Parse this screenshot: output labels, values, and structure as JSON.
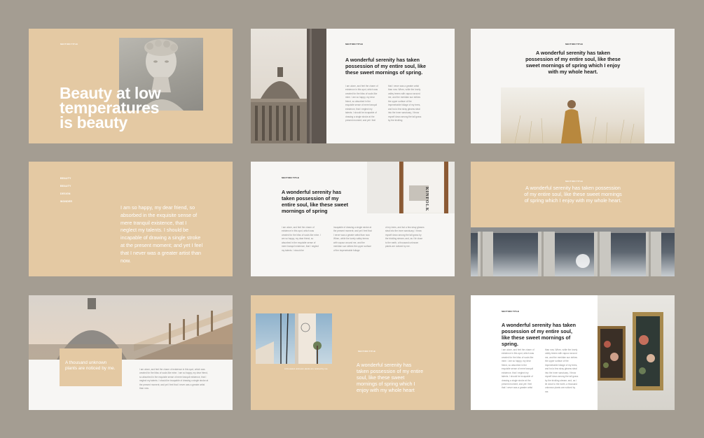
{
  "slide1": {
    "tag": "SECTION TITLE",
    "title_l1": "Beauty at low",
    "title_l2": "temperatures",
    "title_l3": "is beauty"
  },
  "slide2": {
    "tag": "SECTION TITLE",
    "heading": "A wonderful serenity has taken possession of my entire soul, like these sweet mornings of spring.",
    "col1": "I am alone, and feel the charm of existence in this spot, which was created for the bliss of souls like mine. I am so happy, my dear friend, so absorbed in the exquisite sense of mere tranquil existence, that I neglect my talents. I should be incapable of drawing a single stroke at the present moment; and yet I feel",
    "col2": "that I never was a greater artist than now. When, while the lovely valley teems with vapour around me, and the meridian sun strikes the upper surface of the impenetrable foliage of my trees, and but a few stray gleams steal into the inner sanctuary, I throw myself down among the tall grass by the trickling"
  },
  "slide3": {
    "tag": "SECTION TITLE",
    "heading": "A wonderful serenity has taken possession of my entire soul, like these sweet mornings of spring which I enjoy with my whole heart."
  },
  "slide4": {
    "nav": [
      "BEAUTY",
      "BEAUTY",
      "DESIGN",
      "WONDER"
    ],
    "quote": "I am so happy, my dear friend, so absorbed in the exquisite sense of mere tranquil existence, that I neglect my talents. I should be incapable of drawing a single stroke at the present moment; and yet I feel that I never was a greater artist than now."
  },
  "slide5": {
    "tag": "SECTION TITLE",
    "heading": "A wonderful serenity has taken possession of my entire soul, like these sweet mornings of spring",
    "col1": "I am alone, and feel the charm of existence in this spot, which was created for the bliss of souls like mine. I am so happy, my dear friend, so absorbed in the exquisite sense of mere tranquil existence, that I neglect my talents. I should be",
    "col2": "incapable of drawing a single stroke at the present moment; and yet I feel that I never was a greater artist than now. When, while the lovely valley teems with vapour around me, and the meridian sun strikes the upper surface of the impenetrable foliage",
    "col3": "of my trees, and but a few stray gleams steal into the inner sanctuary, I throw myself down among the tall grass by the trickling stream; and, as I lie close to the earth, a thousand unknown plants are noticed by me.",
    "book_label": "KINFOLK"
  },
  "slide6": {
    "tag": "SECTION TITLE",
    "heading": "A wonderful serenity has taken possession of my entire soul, like these sweet mornings of spring which I enjoy with my whole heart."
  },
  "slide7": {
    "caption": "A thousand unknown plants are noticed by me.",
    "body": "I am alone, and feel the charm of existence in this spot, which was created for the bliss of souls like mine. I am so happy, my dear friend, so absorbed in the exquisite sense of mere tranquil existence, that I neglect my talents. I should be incapable of drawing a single stroke at the present moment; and yet I feel that I never was a greater artist than now."
  },
  "slide8": {
    "tag": "SECTION TITLE",
    "caption": "A thousand unknown plants are noticed by me.",
    "heading": "A wonderful serenity has taken possession of my entire soul, like these sweet mornings of spring which I enjoy with my whole heart"
  },
  "slide9": {
    "tag": "SECTION TITLE",
    "heading": "A wonderful serenity has taken possession of my entire soul, like these sweet mornings of spring.",
    "col1": "I am alone, and feel the charm of existence in this spot, which was created for the bliss of souls like mine. I am so happy, my dear friend, so absorbed in the exquisite sense of mere tranquil existence, that I neglect my talents. I should be incapable of drawing a single stroke at the present moment; and yet I feel that I never was a greater artist",
    "col2": "than now. When, while the lovely valley teems with vapour around me, and the meridian sun strikes the upper surface of the impenetrable foliage of my trees, and but a few stray gleams steal into the inner sanctuary, I throw myself down among the tall grass by the trickling stream; and, as I lie close to the earth, a thousand unknown plants are noticed by me."
  }
}
